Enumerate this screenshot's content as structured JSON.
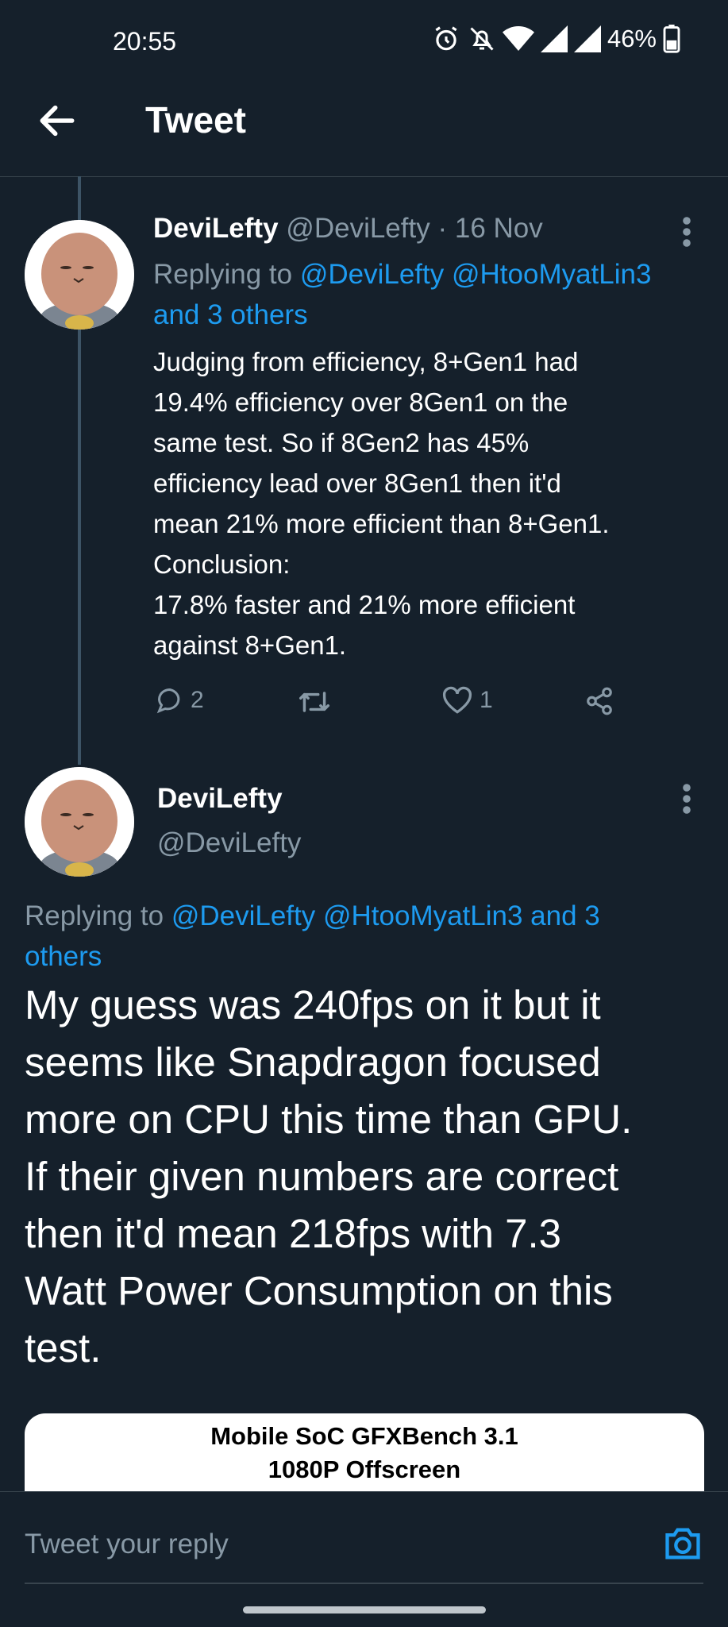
{
  "status_bar": {
    "time": "20:55",
    "battery": "46%"
  },
  "header": {
    "title": "Tweet"
  },
  "parent_tweet": {
    "display_name": "DeviLefty",
    "handle": "@DeviLefty",
    "separator": "·",
    "date": "16 Nov",
    "replying_prefix": "Replying to ",
    "replying_mentions": "@DeviLefty @HtooMyatLin3",
    "replying_more": "and 3 others",
    "lines": [
      "Judging from efficiency, 8+Gen1 had",
      "19.4% efficiency over 8Gen1 on the",
      "same test. So if 8Gen2 has 45%",
      "efficiency lead over 8Gen1 then it'd",
      "mean 21% more efficient than 8+Gen1.",
      "Conclusion:",
      "17.8% faster and 21% more efficient",
      "against 8+Gen1."
    ],
    "reply_count": "2",
    "like_count": "1"
  },
  "main_tweet": {
    "display_name": "DeviLefty",
    "handle": "@DeviLefty",
    "replying_prefix": "Replying to ",
    "replying_line1": "@DeviLefty @HtooMyatLin3 and 3",
    "replying_line2": "others",
    "lines": [
      "My guess was 240fps on it but it",
      "seems like Snapdragon focused",
      "more on CPU this time than GPU.",
      "If their given numbers are correct",
      "then it'd mean 218fps with 7.3",
      "Watt Power Consumption on this",
      "test."
    ],
    "media_title_line1": "Mobile SoC GFXBench 3.1",
    "media_title_line2": "1080P Offscreen"
  },
  "reply_bar": {
    "placeholder": "Tweet your reply"
  },
  "colors": {
    "background": "#15202b",
    "link": "#1d9bf0",
    "muted": "#8899a6"
  }
}
